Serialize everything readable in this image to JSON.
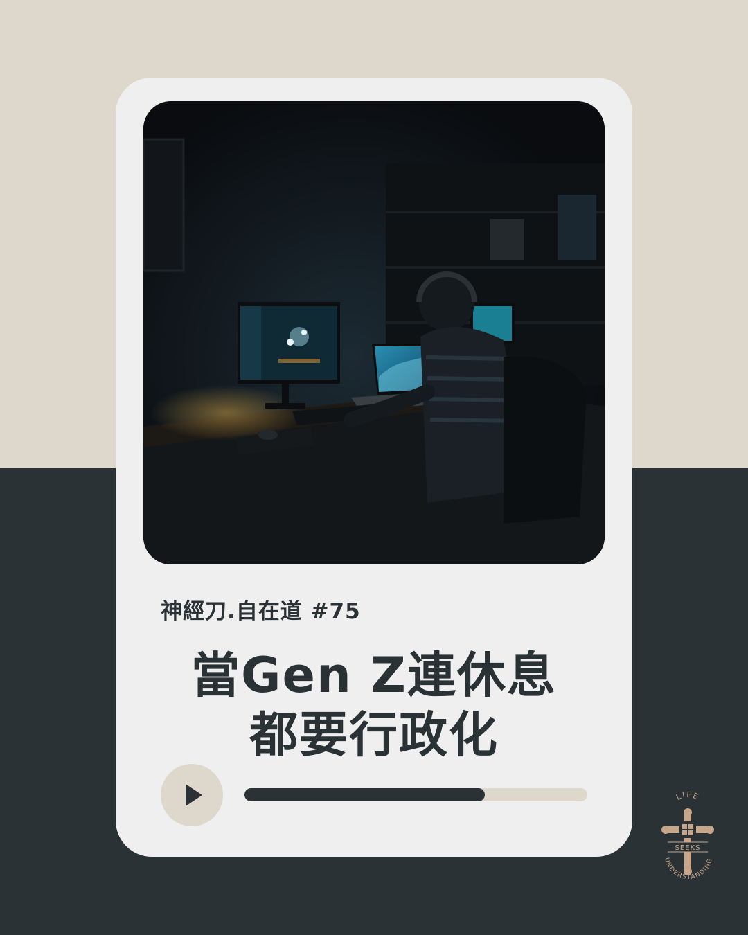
{
  "episode": {
    "label": "神經刀.自在道 #75"
  },
  "title": {
    "line1": "當Gen Z連休息",
    "line2": "都要行政化"
  },
  "player": {
    "progress": 0.7
  },
  "logo": {
    "top": "LIFE",
    "middle": "SEEKS",
    "bottom": "UNDERSTANDING"
  },
  "colors": {
    "beige": "#ddd8cb",
    "dark": "#2b3236",
    "card": "#efefef",
    "logo": "#c7a58a"
  }
}
